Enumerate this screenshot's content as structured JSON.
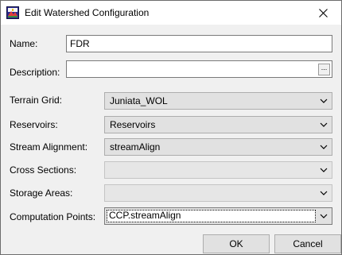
{
  "window": {
    "title": "Edit Watershed Configuration",
    "icon": "watershed-app-icon",
    "close_icon": "close-icon"
  },
  "form": {
    "name": {
      "label": "Name:",
      "value": "FDR"
    },
    "description": {
      "label": "Description:",
      "value": "",
      "browse_label": "..."
    },
    "terrain_grid": {
      "label": "Terrain Grid:",
      "value": "Juniata_WOL"
    },
    "reservoirs": {
      "label": "Reservoirs:",
      "value": "Reservoirs"
    },
    "stream_alignment": {
      "label": "Stream Alignment:",
      "value": "streamAlign"
    },
    "cross_sections": {
      "label": "Cross Sections:",
      "value": ""
    },
    "storage_areas": {
      "label": "Storage Areas:",
      "value": ""
    },
    "computation_points": {
      "label": "Computation Points:",
      "value": "CCP.streamAlign"
    }
  },
  "buttons": {
    "ok_label": "OK",
    "cancel_label": "Cancel"
  }
}
